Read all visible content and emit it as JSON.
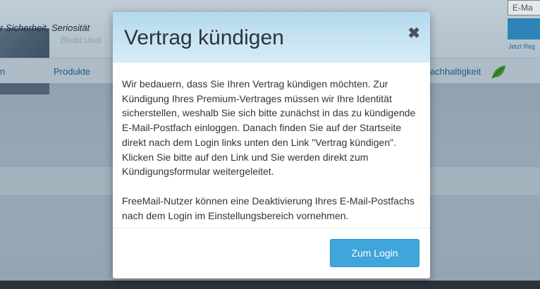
{
  "background": {
    "tagline": "r Sicherheit, Seriosität",
    "faint_text": "Bleibt Unal",
    "email_placeholder": "E-Ma",
    "login_link": "Jetzt Reg",
    "nav": {
      "item_left": "n",
      "item_produkte": "Produkte",
      "item_nachhaltigkeit": "achhaltigkeit"
    }
  },
  "modal": {
    "title": "Vertrag kündigen",
    "close_symbol": "✖",
    "paragraph1": "Wir bedauern, dass Sie Ihren Vertrag kündigen möchten. Zur Kündigung Ihres Premium-Vertrages müssen wir Ihre Identität sicherstellen, weshalb Sie sich bitte zunächst in das zu kündigende E-Mail-Postfach einloggen. Danach finden Sie auf der Startseite direkt nach dem Login links unten den Link \"Vertrag kündigen\". Klicken Sie bitte auf den Link und Sie werden direkt zum Kündigungsformular weitergeleitet.",
    "paragraph2": "FreeMail-Nutzer können eine Deaktivierung Ihres E-Mail-Postfachs nach dem Login im Einstellungsbereich vornehmen.",
    "login_button": "Zum Login"
  },
  "colors": {
    "accent": "#3fa5da",
    "header_gradient_top": "#b4d9ee",
    "nav_link": "#1f5f8d",
    "leaf_green": "#3c9a2c"
  },
  "icons": {
    "close": "close-icon",
    "nav_leaf": "leaf-icon"
  }
}
